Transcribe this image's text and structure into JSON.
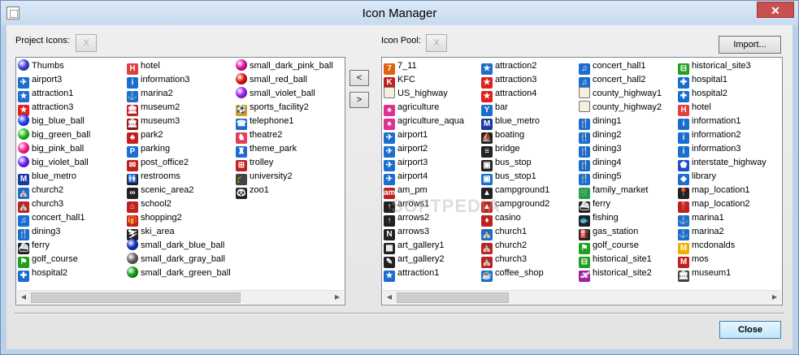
{
  "window": {
    "title": "Icon Manager",
    "close_glyph": "✕"
  },
  "project": {
    "label": "Project Icons:",
    "clear_label": "X",
    "columns": [
      [
        {
          "label": "Thumbs",
          "icon": "ball",
          "color": "#4040e0"
        },
        {
          "label": "airport3",
          "icon": "plane",
          "color": "#1a6ecf"
        },
        {
          "label": "attraction1",
          "icon": "star",
          "color": "#1a6ecf"
        },
        {
          "label": "attraction3",
          "icon": "star",
          "color": "#e02020"
        },
        {
          "label": "big_blue_ball",
          "icon": "ball",
          "color": "#2040ff"
        },
        {
          "label": "big_green_ball",
          "icon": "ball",
          "color": "#20c020"
        },
        {
          "label": "big_pink_ball",
          "icon": "ball",
          "color": "#ff2090"
        },
        {
          "label": "big_violet_ball",
          "icon": "ball",
          "color": "#7020ff"
        },
        {
          "label": "blue_metro",
          "icon": "metro",
          "color": "#1a3a9f"
        },
        {
          "label": "church2",
          "icon": "church",
          "color": "#1a6ecf"
        },
        {
          "label": "church3",
          "icon": "church",
          "color": "#c02020"
        },
        {
          "label": "concert_hall1",
          "icon": "note",
          "color": "#1a6ecf"
        },
        {
          "label": "dining3",
          "icon": "dining",
          "color": "#1a6ecf"
        },
        {
          "label": "ferry",
          "icon": "ferry",
          "color": "#222"
        },
        {
          "label": "golf_course",
          "icon": "flag",
          "color": "#20a020"
        },
        {
          "label": "hospital2",
          "icon": "cross",
          "color": "#1a6ecf"
        }
      ],
      [
        {
          "label": "hotel",
          "icon": "hotel",
          "color": "#e04040"
        },
        {
          "label": "information3",
          "icon": "info",
          "color": "#1a6ecf"
        },
        {
          "label": "marina2",
          "icon": "anchor",
          "color": "#1a6ecf"
        },
        {
          "label": "museum2",
          "icon": "museum",
          "color": "#c02020"
        },
        {
          "label": "museum3",
          "icon": "museum",
          "color": "#8a1a1a"
        },
        {
          "label": "park2",
          "icon": "tree",
          "color": "#c02020"
        },
        {
          "label": "parking",
          "icon": "parking",
          "color": "#1a6ecf"
        },
        {
          "label": "post_office2",
          "icon": "mail",
          "color": "#c02020"
        },
        {
          "label": "restrooms",
          "icon": "wc",
          "color": "#222"
        },
        {
          "label": "scenic_area2",
          "icon": "binoc",
          "color": "#222"
        },
        {
          "label": "school2",
          "icon": "school",
          "color": "#c02020"
        },
        {
          "label": "shopping2",
          "icon": "gift",
          "color": "#c02020"
        },
        {
          "label": "ski_area",
          "icon": "ski",
          "color": "#222"
        },
        {
          "label": "small_dark_blue_ball",
          "icon": "ball",
          "color": "#1030c0"
        },
        {
          "label": "small_dark_gray_ball",
          "icon": "ball",
          "color": "#606060"
        },
        {
          "label": "small_dark_green_ball",
          "icon": "ball",
          "color": "#10a010"
        }
      ],
      [
        {
          "label": "small_dark_pink_ball",
          "icon": "ball",
          "color": "#e010a0"
        },
        {
          "label": "small_red_ball",
          "icon": "ball",
          "color": "#e01010"
        },
        {
          "label": "small_violet_ball",
          "icon": "ball",
          "color": "#a020f0"
        },
        {
          "label": "sports_facility2",
          "icon": "sports",
          "color": "#d0a020"
        },
        {
          "label": "telephone1",
          "icon": "phone",
          "color": "#1a6ecf"
        },
        {
          "label": "theatre2",
          "icon": "theatre",
          "color": "#e04060"
        },
        {
          "label": "theme_park",
          "icon": "theme",
          "color": "#1a6ecf"
        },
        {
          "label": "trolley",
          "icon": "trolley",
          "color": "#c02020"
        },
        {
          "label": "university2",
          "icon": "cap",
          "color": "#444"
        },
        {
          "label": "zoo1",
          "icon": "zoo",
          "color": "#222"
        }
      ]
    ]
  },
  "pool": {
    "label": "Icon Pool:",
    "clear_label": "X",
    "import_label": "Import...",
    "columns": [
      [
        {
          "label": "7_11",
          "icon": "seven",
          "color": "#e06010"
        },
        {
          "label": "KFC",
          "icon": "kfc",
          "color": "#c02020"
        },
        {
          "label": "US_highway",
          "icon": "shield",
          "color": "#ddd"
        },
        {
          "label": "agriculture",
          "icon": "farm",
          "color": "#e03090"
        },
        {
          "label": "agriculture_aqua",
          "icon": "farm",
          "color": "#e03090"
        },
        {
          "label": "airport1",
          "icon": "plane",
          "color": "#1a6ecf"
        },
        {
          "label": "airport2",
          "icon": "plane",
          "color": "#1a6ecf"
        },
        {
          "label": "airport3",
          "icon": "plane",
          "color": "#1a6ecf"
        },
        {
          "label": "airport4",
          "icon": "plane",
          "color": "#1a6ecf"
        },
        {
          "label": "am_pm",
          "icon": "ampm",
          "color": "#c02020"
        },
        {
          "label": "arrows1",
          "icon": "arrow",
          "color": "#222"
        },
        {
          "label": "arrows2",
          "icon": "arrow",
          "color": "#222"
        },
        {
          "label": "arrows3",
          "icon": "compass",
          "color": "#222"
        },
        {
          "label": "art_gallery1",
          "icon": "art",
          "color": "#222"
        },
        {
          "label": "art_gallery2",
          "icon": "palette",
          "color": "#222"
        },
        {
          "label": "attraction1",
          "icon": "star",
          "color": "#1a6ecf"
        }
      ],
      [
        {
          "label": "attraction2",
          "icon": "star",
          "color": "#1a6ecf"
        },
        {
          "label": "attraction3",
          "icon": "star",
          "color": "#e02020"
        },
        {
          "label": "attraction4",
          "icon": "star",
          "color": "#e02020"
        },
        {
          "label": "bar",
          "icon": "bar",
          "color": "#1a6ecf"
        },
        {
          "label": "blue_metro",
          "icon": "metro",
          "color": "#1a3a9f"
        },
        {
          "label": "boating",
          "icon": "boat",
          "color": "#222"
        },
        {
          "label": "bridge",
          "icon": "bridge",
          "color": "#222"
        },
        {
          "label": "bus_stop",
          "icon": "bus",
          "color": "#222"
        },
        {
          "label": "bus_stop1",
          "icon": "bus",
          "color": "#1a6ecf"
        },
        {
          "label": "campground1",
          "icon": "tent",
          "color": "#222"
        },
        {
          "label": "campground2",
          "icon": "tent",
          "color": "#c02020"
        },
        {
          "label": "casino",
          "icon": "casino",
          "color": "#c02020"
        },
        {
          "label": "church1",
          "icon": "church",
          "color": "#1a6ecf"
        },
        {
          "label": "church2",
          "icon": "church",
          "color": "#c02020"
        },
        {
          "label": "church3",
          "icon": "church",
          "color": "#c02020"
        },
        {
          "label": "coffee_shop",
          "icon": "cup",
          "color": "#1a6ecf"
        }
      ],
      [
        {
          "label": "concert_hall1",
          "icon": "note",
          "color": "#1a6ecf"
        },
        {
          "label": "concert_hall2",
          "icon": "note",
          "color": "#1a6ecf"
        },
        {
          "label": "county_highway1",
          "icon": "shield",
          "color": "#eee"
        },
        {
          "label": "county_highway2",
          "icon": "shield",
          "color": "#eee"
        },
        {
          "label": "dining1",
          "icon": "dining",
          "color": "#1a6ecf"
        },
        {
          "label": "dining2",
          "icon": "dining",
          "color": "#1a6ecf"
        },
        {
          "label": "dining3",
          "icon": "dining",
          "color": "#1a6ecf"
        },
        {
          "label": "dining4",
          "icon": "dining",
          "color": "#1a6ecf"
        },
        {
          "label": "dining5",
          "icon": "dining",
          "color": "#1a6ecf"
        },
        {
          "label": "family_market",
          "icon": "market",
          "color": "#20a040"
        },
        {
          "label": "ferry",
          "icon": "ferry",
          "color": "#222"
        },
        {
          "label": "fishing",
          "icon": "fish",
          "color": "#222"
        },
        {
          "label": "gas_station",
          "icon": "gas",
          "color": "#222"
        },
        {
          "label": "golf_course",
          "icon": "flag",
          "color": "#20a020"
        },
        {
          "label": "historical_site1",
          "icon": "hist",
          "color": "#20a020"
        },
        {
          "label": "historical_site2",
          "icon": "hscript",
          "color": "#a020a0"
        }
      ],
      [
        {
          "label": "historical_site3",
          "icon": "hist",
          "color": "#20a020"
        },
        {
          "label": "hospital1",
          "icon": "cross",
          "color": "#1a6ecf"
        },
        {
          "label": "hospital2",
          "icon": "cross",
          "color": "#1a6ecf"
        },
        {
          "label": "hotel",
          "icon": "hotel",
          "color": "#e04040"
        },
        {
          "label": "information1",
          "icon": "info",
          "color": "#1a6ecf"
        },
        {
          "label": "information2",
          "icon": "info",
          "color": "#1a6ecf"
        },
        {
          "label": "information3",
          "icon": "info",
          "color": "#1a6ecf"
        },
        {
          "label": "interstate_highway",
          "icon": "ishield",
          "color": "#1a4ecf"
        },
        {
          "label": "library",
          "icon": "book",
          "color": "#1a6ecf"
        },
        {
          "label": "map_location1",
          "icon": "pin",
          "color": "#222"
        },
        {
          "label": "map_location2",
          "icon": "pin",
          "color": "#c02020"
        },
        {
          "label": "marina1",
          "icon": "anchor",
          "color": "#1a6ecf"
        },
        {
          "label": "marina2",
          "icon": "anchor",
          "color": "#1a6ecf"
        },
        {
          "label": "mcdonalds",
          "icon": "mcd",
          "color": "#f0b000"
        },
        {
          "label": "mos",
          "icon": "mos",
          "color": "#c02020"
        },
        {
          "label": "museum1",
          "icon": "museum",
          "color": "#444"
        }
      ]
    ]
  },
  "transfer": {
    "left_label": "<",
    "right_label": ">"
  },
  "footer": {
    "close_label": "Close"
  },
  "watermark": "SOFTPEDIA"
}
